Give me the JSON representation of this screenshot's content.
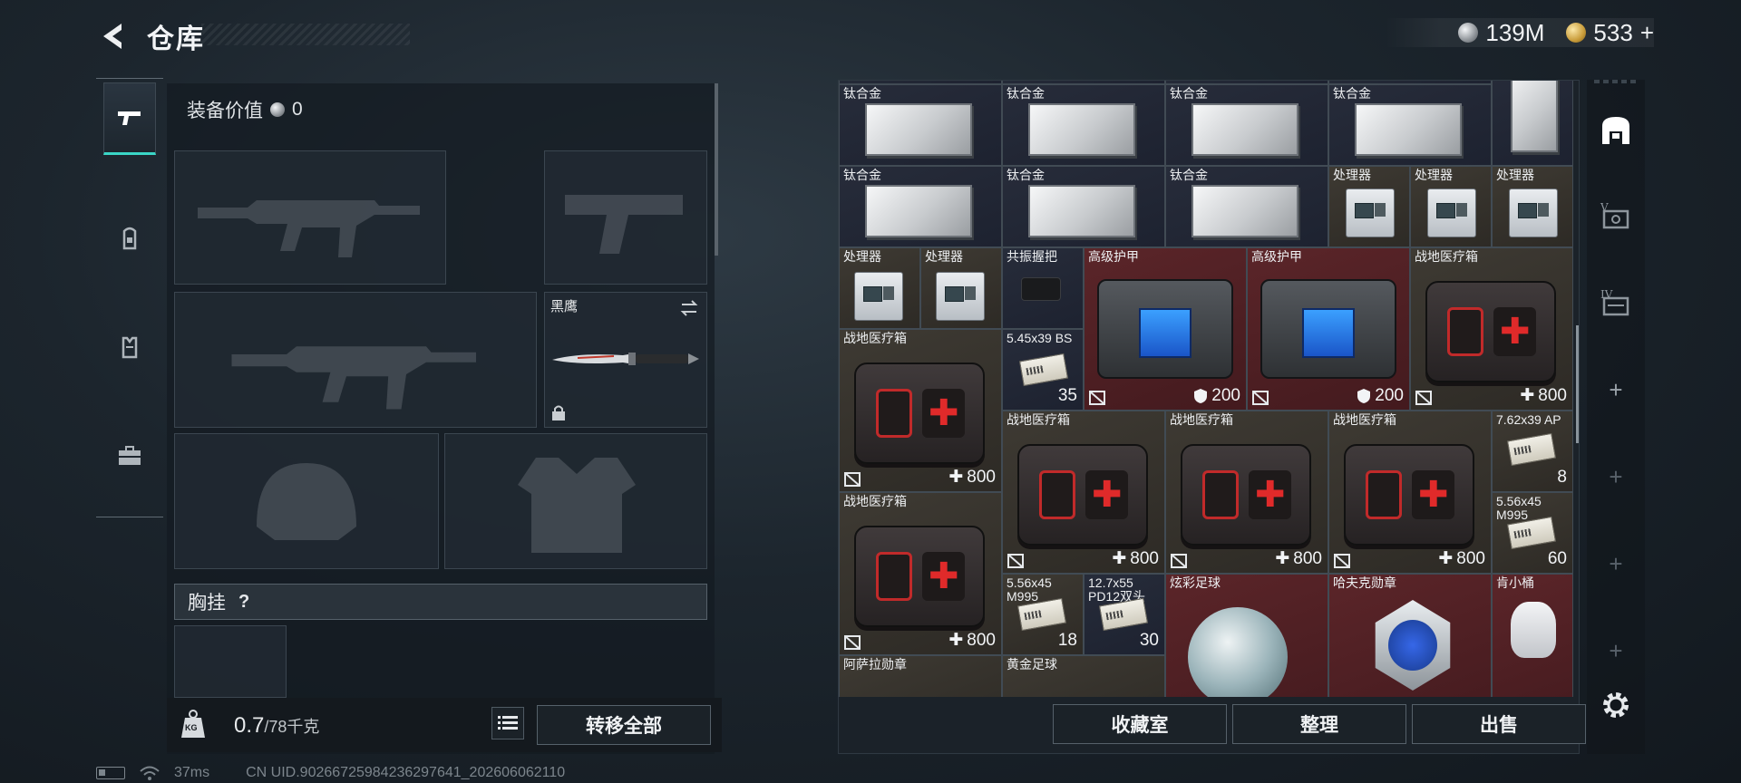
{
  "header": {
    "title": "仓库",
    "currency_silver": "139M",
    "currency_gold": "533",
    "gold_add": "+"
  },
  "loadout": {
    "value_label": "装备价值",
    "value": "0",
    "melee_name": "黑鹰",
    "chest_rig_label": "胸挂",
    "chest_rig_help": "?",
    "weight_current": "0.7",
    "weight_max": "/78千克",
    "kg_label": "KG",
    "transfer_all": "转移全部"
  },
  "storage": {
    "cells": [
      {
        "label": "钛合金",
        "count": ""
      },
      {
        "label": "钛合金",
        "count": ""
      },
      {
        "label": "钛合金",
        "count": ""
      },
      {
        "label": "钛合金",
        "count": ""
      },
      {
        "label": "钛合金",
        "count": ""
      },
      {
        "label": "钛合金",
        "count": ""
      },
      {
        "label": "钛合金",
        "count": ""
      },
      {
        "label": "处理器",
        "count": ""
      },
      {
        "label": "处理器",
        "count": ""
      },
      {
        "label": "处理器",
        "count": ""
      },
      {
        "label": "处理器",
        "count": ""
      },
      {
        "label": "处理器",
        "count": ""
      },
      {
        "label": "共振握把",
        "count": ""
      },
      {
        "label": "高级护甲",
        "count": "200"
      },
      {
        "label": "高级护甲",
        "count": "200"
      },
      {
        "label": "战地医疗箱",
        "count": "800"
      },
      {
        "label": "战地医疗箱",
        "count": "800"
      },
      {
        "label": "5.45x39 BS",
        "count": "35"
      },
      {
        "label": "战地医疗箱",
        "count": "800"
      },
      {
        "label": "战地医疗箱",
        "count": "800"
      },
      {
        "label": "战地医疗箱",
        "count": "800"
      },
      {
        "label": "7.62x39 AP",
        "count": "8"
      },
      {
        "label": "战地医疗箱",
        "count": "800"
      },
      {
        "label": "5.56x45 M995",
        "count": "60"
      },
      {
        "label": "5.56x45 M995",
        "count": "18"
      },
      {
        "label": "12.7x55 PD12双头",
        "count": "30"
      },
      {
        "label": "炫彩足球",
        "count": ""
      },
      {
        "label": "哈夫克勋章",
        "count": ""
      },
      {
        "label": "肯小桶",
        "count": ""
      },
      {
        "label": "阿萨拉勋章",
        "count": ""
      },
      {
        "label": "黄金足球",
        "count": ""
      }
    ],
    "actions": {
      "collection": "收藏室",
      "sort": "整理",
      "sell": "出售"
    }
  },
  "status": {
    "ping": "37ms",
    "uid": "CN UID.90266725984236297641_202606062110"
  },
  "colors": {
    "accent": "#3ad6c6",
    "cell_red": "#5b2529",
    "cell_brown": "#3e3a33",
    "cell_dark": "#272c3a"
  },
  "icons": {
    "left_rail": [
      "pistol-icon",
      "backpack-icon",
      "vest-icon",
      "briefcase-icon"
    ],
    "right_rail": [
      "vault-icon",
      "stash-v-icon",
      "stash-iv-icon",
      "add-icon",
      "settings-icon"
    ]
  }
}
